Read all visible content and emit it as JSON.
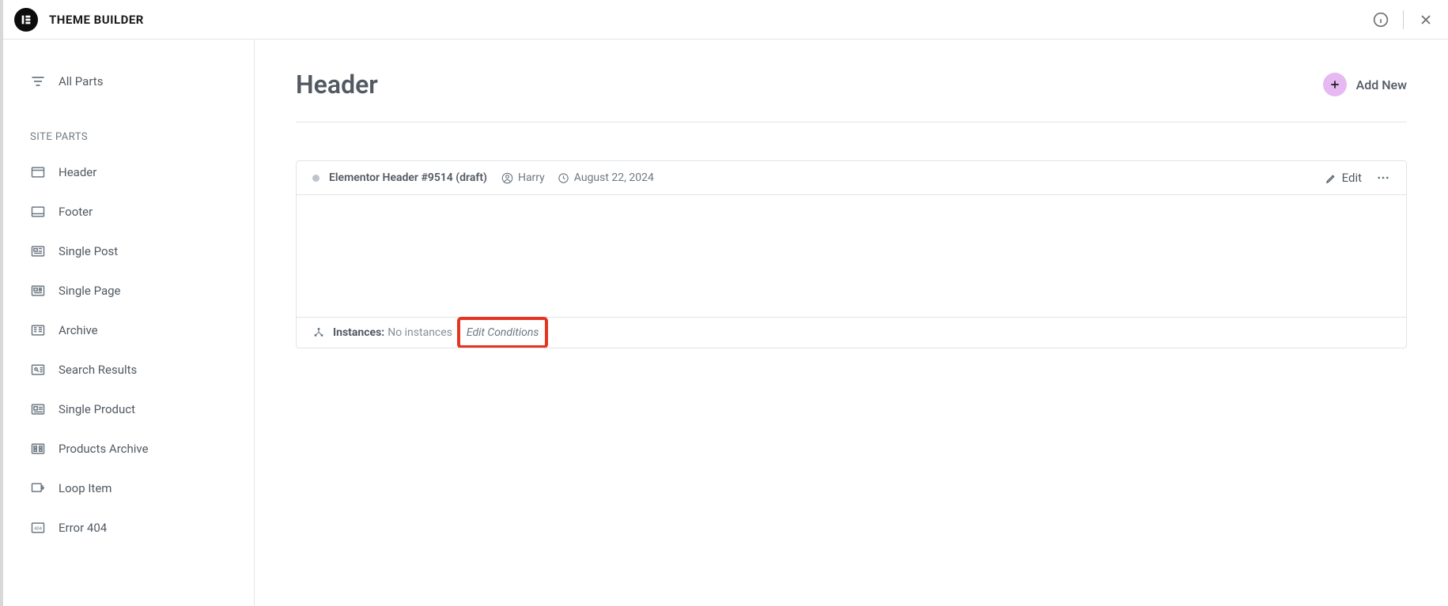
{
  "topbar": {
    "title": "THEME BUILDER"
  },
  "sidebar": {
    "all_parts": "All Parts",
    "heading": "SITE PARTS",
    "items": [
      {
        "label": "Header"
      },
      {
        "label": "Footer"
      },
      {
        "label": "Single Post"
      },
      {
        "label": "Single Page"
      },
      {
        "label": "Archive"
      },
      {
        "label": "Search Results"
      },
      {
        "label": "Single Product"
      },
      {
        "label": "Products Archive"
      },
      {
        "label": "Loop Item"
      },
      {
        "label": "Error 404"
      }
    ]
  },
  "page": {
    "title": "Header",
    "add_new": "Add New"
  },
  "template": {
    "title": "Elementor Header #9514 (draft)",
    "author": "Harry",
    "date": "August 22, 2024",
    "edit": "Edit",
    "instances_label": "Instances:",
    "instances_value": "No instances",
    "edit_conditions": "Edit Conditions"
  }
}
